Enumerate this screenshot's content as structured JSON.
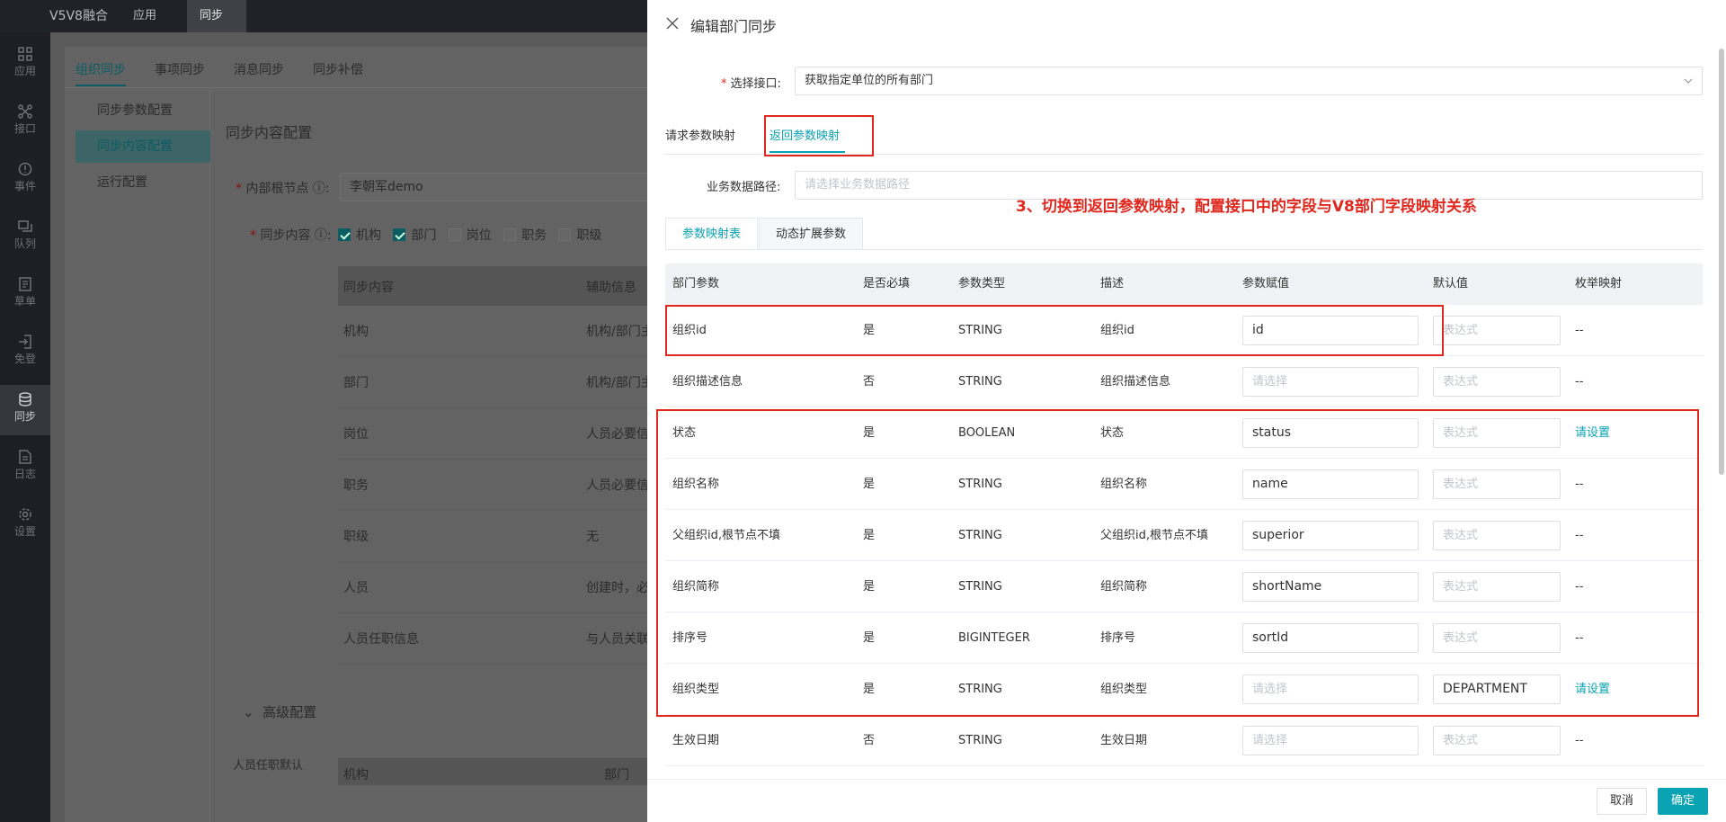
{
  "app": {
    "title": "V5V8融合",
    "tabs": [
      {
        "label": "应用"
      },
      {
        "label": "同步"
      }
    ]
  },
  "sidebar": {
    "items": [
      {
        "label": "应用",
        "icon": "grid-icon"
      },
      {
        "label": "接口",
        "icon": "interface-icon"
      },
      {
        "label": "事件",
        "icon": "event-icon"
      },
      {
        "label": "队列",
        "icon": "queue-icon"
      },
      {
        "label": "草单",
        "icon": "draft-icon"
      },
      {
        "label": "免登",
        "icon": "login-icon"
      },
      {
        "label": "同步",
        "icon": "sync-icon"
      },
      {
        "label": "日志",
        "icon": "log-icon"
      },
      {
        "label": "设置",
        "icon": "gear-icon"
      }
    ]
  },
  "background": {
    "tabs": [
      "组织同步",
      "事项同步",
      "消息同步",
      "同步补偿"
    ],
    "left_menu": [
      "同步参数配置",
      "同步内容配置",
      "运行配置"
    ],
    "section_title": "同步内容配置",
    "root_label": "内部根节点",
    "root_value": "李朝军demo",
    "content_label": "同步内容",
    "content_options": [
      {
        "label": "机构",
        "checked": true
      },
      {
        "label": "部门",
        "checked": true
      },
      {
        "label": "岗位",
        "checked": false
      },
      {
        "label": "职务",
        "checked": false
      },
      {
        "label": "职级",
        "checked": false
      }
    ],
    "table_headers": [
      "同步内容",
      "辅助信息"
    ],
    "table_rows": [
      [
        "机构",
        "机构/部门主"
      ],
      [
        "部门",
        "机构/部门主"
      ],
      [
        "岗位",
        "人员必要信"
      ],
      [
        "职务",
        "人员必要信"
      ],
      [
        "职级",
        "无"
      ],
      [
        "人员",
        "创建时，必"
      ],
      [
        "人员任职信息",
        "与人员关联"
      ]
    ],
    "advanced_title": "高级配置",
    "assign_label": "人员任职默认",
    "sub_headers": [
      "机构",
      "部门"
    ]
  },
  "drawer": {
    "title": "编辑部门同步",
    "interface_label": "选择接口:",
    "interface_value": "获取指定单位的所有部门",
    "param_tabs": [
      "请求参数映射",
      "返回参数映射"
    ],
    "path_label": "业务数据路径:",
    "path_placeholder": "请选择业务数据路径",
    "annotation": "3、切换到返回参数映射，配置接口中的字段与V8部门字段映射关系",
    "sub_tabs": [
      "参数映射表",
      "动态扩展参数"
    ],
    "columns": [
      "部门参数",
      "是否必填",
      "参数类型",
      "描述",
      "参数赋值",
      "默认值",
      "枚举映射"
    ],
    "rows": [
      {
        "param": "组织id",
        "required": "是",
        "type": "STRING",
        "desc": "组织id",
        "assign": "id",
        "assign_ph": false,
        "default": "表达式",
        "default_ph": true,
        "enum": "--",
        "enum_link": false
      },
      {
        "param": "组织描述信息",
        "required": "否",
        "type": "STRING",
        "desc": "组织描述信息",
        "assign": "请选择",
        "assign_ph": true,
        "default": "表达式",
        "default_ph": true,
        "enum": "--",
        "enum_link": false
      },
      {
        "param": "状态",
        "required": "是",
        "type": "BOOLEAN",
        "desc": "状态",
        "assign": "status",
        "assign_ph": false,
        "default": "表达式",
        "default_ph": true,
        "enum": "请设置",
        "enum_link": true
      },
      {
        "param": "组织名称",
        "required": "是",
        "type": "STRING",
        "desc": "组织名称",
        "assign": "name",
        "assign_ph": false,
        "default": "表达式",
        "default_ph": true,
        "enum": "--",
        "enum_link": false
      },
      {
        "param": "父组织id,根节点不填",
        "required": "是",
        "type": "STRING",
        "desc": "父组织id,根节点不填",
        "assign": "superior",
        "assign_ph": false,
        "default": "表达式",
        "default_ph": true,
        "enum": "--",
        "enum_link": false
      },
      {
        "param": "组织简称",
        "required": "是",
        "type": "STRING",
        "desc": "组织简称",
        "assign": "shortName",
        "assign_ph": false,
        "default": "表达式",
        "default_ph": true,
        "enum": "--",
        "enum_link": false
      },
      {
        "param": "排序号",
        "required": "是",
        "type": "BIGINTEGER",
        "desc": "排序号",
        "assign": "sortId",
        "assign_ph": false,
        "default": "表达式",
        "default_ph": true,
        "enum": "--",
        "enum_link": false
      },
      {
        "param": "组织类型",
        "required": "是",
        "type": "STRING",
        "desc": "组织类型",
        "assign": "请选择",
        "assign_ph": true,
        "default": "DEPARTMENT",
        "default_ph": false,
        "enum": "请设置",
        "enum_link": true
      },
      {
        "param": "生效日期",
        "required": "否",
        "type": "STRING",
        "desc": "生效日期",
        "assign": "请选择",
        "assign_ph": true,
        "default": "表达式",
        "default_ph": true,
        "enum": "--",
        "enum_link": false
      }
    ],
    "cancel_label": "取消",
    "ok_label": "确定"
  },
  "colors": {
    "accent": "#0aa3b3",
    "annotation": "#e0281e"
  }
}
